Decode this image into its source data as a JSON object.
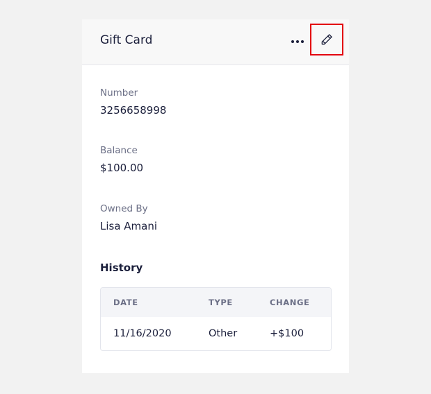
{
  "card": {
    "title": "Gift Card",
    "actions": {
      "more_icon": "more-horizontal-icon",
      "edit_icon": "pencil-icon",
      "highlight_color": "#e3000f"
    }
  },
  "fields": {
    "number": {
      "label": "Number",
      "value": "3256658998"
    },
    "balance": {
      "label": "Balance",
      "value": "$100.00"
    },
    "owner": {
      "label": "Owned By",
      "value": "Lisa Amani"
    }
  },
  "history": {
    "title": "History",
    "columns": [
      "DATE",
      "TYPE",
      "CHANGE"
    ],
    "rows": [
      {
        "date": "11/16/2020",
        "type": "Other",
        "change": "+$100"
      }
    ]
  }
}
